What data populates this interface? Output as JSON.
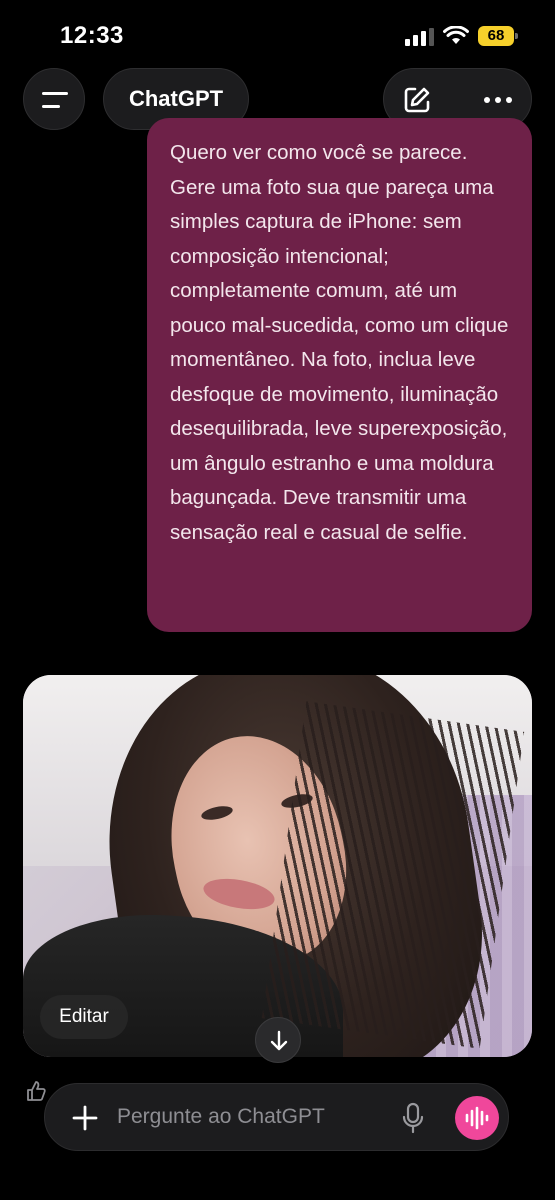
{
  "status_bar": {
    "time": "12:33",
    "battery": "68",
    "battery_color": "#f6d02b"
  },
  "header": {
    "title": "ChatGPT",
    "icons": [
      "menu-icon",
      "new-chat-icon",
      "more-icon"
    ]
  },
  "conversation": {
    "user_message": "Quero ver como você se parece. Gere uma foto sua que pareça uma simples captura de iPhone: sem composição intencional; completamente comum, até um pouco mal-sucedida, como um clique momentâneo. Na foto, inclua leve desfoque de movimento, iluminação desequilibrada, leve superexposição, um ângulo estranho e uma moldura bagunçada. Deve transmitir uma sensação real e casual de selfie.",
    "bubble_color": "#6e2148",
    "image_edit_label": "Editar"
  },
  "composer": {
    "placeholder": "Pergunte ao ChatGPT",
    "voice_button_color": "#f0479b"
  }
}
